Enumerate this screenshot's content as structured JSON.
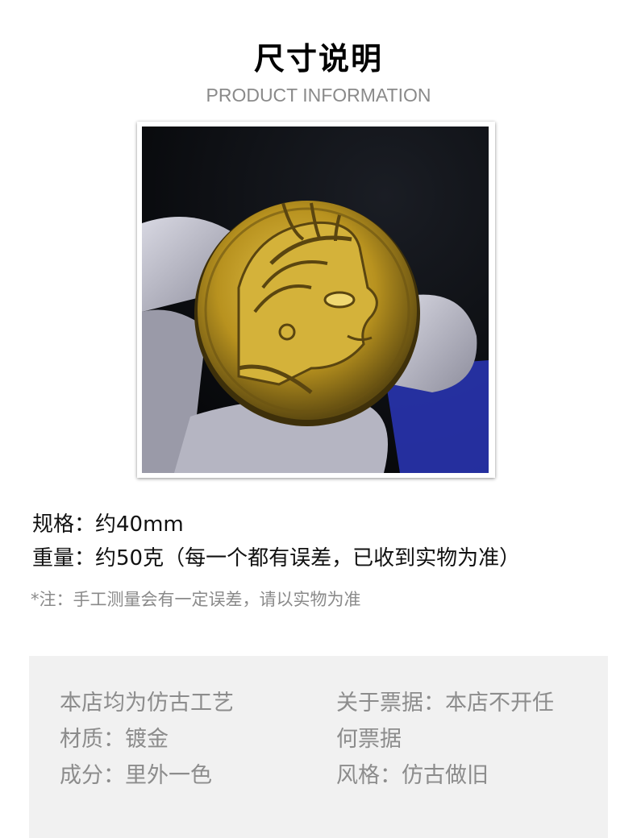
{
  "header": {
    "title": "尺寸说明",
    "subtitle": "PRODUCT INFORMATION"
  },
  "product_image": {
    "icon": "gold-coin-photo",
    "colors": {
      "coin": "#c9a52c",
      "background": "#0b0d12",
      "glove": "#c9c9d4",
      "accent": "#2a36b8"
    }
  },
  "specs": {
    "size": "规格：约40mm",
    "weight": "重量：约50克（每一个都有误差，已收到实物为准）",
    "note": "*注：手工测量会有一定误差，请以实物为准"
  },
  "info_panel": {
    "left": [
      "本店均为仿古工艺",
      "材质：镀金",
      "成分：里外一色"
    ],
    "right": [
      "关于票据：本店不开任",
      "何票据",
      "风格：仿古做旧"
    ]
  }
}
